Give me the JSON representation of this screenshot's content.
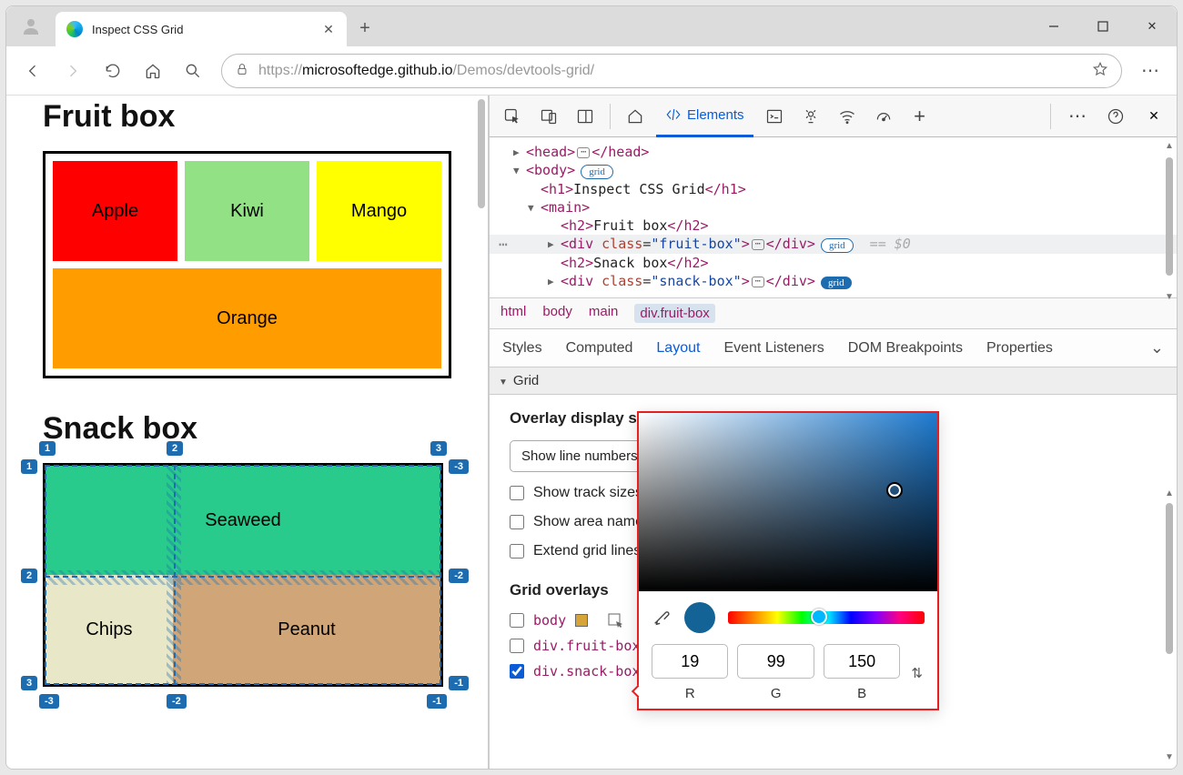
{
  "browser": {
    "tab_title": "Inspect CSS Grid",
    "url_prefix": "https://",
    "url_domain": "microsoftedge.github.io",
    "url_path": "/Demos/devtools-grid/"
  },
  "page": {
    "h_fruit": "Fruit box",
    "h_snack": "Snack box",
    "fruits": {
      "apple": "Apple",
      "kiwi": "Kiwi",
      "mango": "Mango",
      "orange": "Orange"
    },
    "snacks": {
      "seaweed": "Seaweed",
      "chips": "Chips",
      "peanut": "Peanut"
    },
    "grid_labels": {
      "col_top": [
        "1",
        "2",
        "3"
      ],
      "row_left": [
        "1",
        "2",
        "3"
      ],
      "col_bottom": [
        "-3",
        "-2",
        "-1"
      ],
      "row_right": [
        "-3",
        "-2",
        "-1"
      ]
    }
  },
  "devtools": {
    "main_tabs": {
      "elements": "Elements"
    },
    "dom": {
      "head_open": "<head>",
      "head_close": "</head>",
      "body_open": "<body>",
      "grid_badge": "grid",
      "h1_open": "<h1>",
      "h1_text": "Inspect CSS Grid",
      "h1_close": "</h1>",
      "main_open": "<main>",
      "h2a_open": "<h2>",
      "h2a_text": "Fruit box",
      "h2a_close": "</h2>",
      "div_open": "<div ",
      "class_attr": "class",
      "fruit_val": "\"fruit-box\"",
      "div_mid": ">",
      "div_close": "</div>",
      "sel_suffix": "== $0",
      "h2b_open": "<h2>",
      "h2b_text": "Snack box",
      "h2b_close": "</h2>",
      "snack_val": "\"snack-box\""
    },
    "crumbs": {
      "html": "html",
      "body": "body",
      "main": "main",
      "sel": "div.fruit-box"
    },
    "styles_tabs": {
      "styles": "Styles",
      "computed": "Computed",
      "layout": "Layout",
      "events": "Event Listeners",
      "dom_bp": "DOM Breakpoints",
      "props": "Properties"
    },
    "grid_section": "Grid",
    "layout": {
      "h_settings": "Overlay display settings",
      "select": "Show line numbers",
      "cb_track": "Show track sizes",
      "cb_area": "Show area names",
      "cb_extend": "Extend grid lines",
      "h_overlays": "Grid overlays",
      "ov_body": "body",
      "ov_fruit": "div.fruit-box",
      "ov_snack": "div.snack-box"
    },
    "picker": {
      "r": "19",
      "g": "99",
      "b": "150",
      "lbl_r": "R",
      "lbl_g": "G",
      "lbl_b": "B",
      "swatch": "#136396",
      "hue_pos": "42%"
    },
    "overlay_swatches": {
      "body": "#d6a437",
      "fruit": "#d63a3a",
      "snack": "#136396"
    }
  }
}
